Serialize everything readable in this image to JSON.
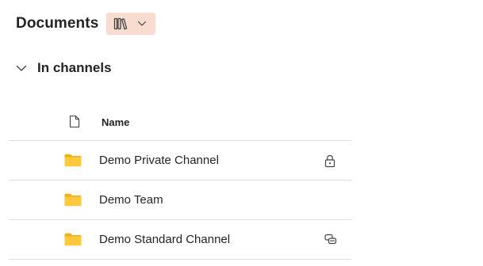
{
  "header": {
    "title": "Documents",
    "library_switcher_icon": "library-icon",
    "library_switcher_chevron": "chevron-down-icon"
  },
  "section": {
    "title": "In channels",
    "toggle_icon": "chevron-down-icon"
  },
  "table": {
    "columns": {
      "type_icon": "document-icon",
      "name": "Name"
    },
    "rows": [
      {
        "name": "Demo Private Channel",
        "icon": "folder-icon",
        "badge": "lock-icon"
      },
      {
        "name": "Demo Team",
        "icon": "folder-icon",
        "badge": ""
      },
      {
        "name": "Demo Standard Channel",
        "icon": "folder-icon",
        "badge": "shared-link-icon"
      }
    ]
  },
  "colors": {
    "switcher_background": "#f8dccf",
    "folder_fill": "#ffc83d",
    "folder_tab": "#f1b114",
    "divider": "#e1dfdd",
    "text": "#242424"
  }
}
